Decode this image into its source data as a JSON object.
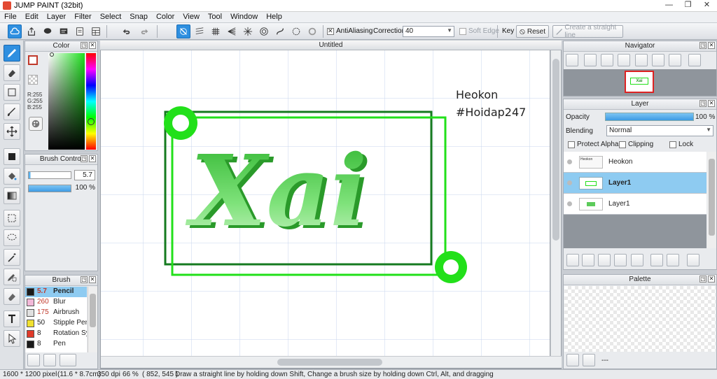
{
  "window": {
    "title": "JUMP PAINT (32bit)"
  },
  "menu": [
    "File",
    "Edit",
    "Layer",
    "Filter",
    "Select",
    "Snap",
    "Color",
    "View",
    "Tool",
    "Window",
    "Help"
  ],
  "toolbar": {
    "antialiasing_label": "AntiAliasing",
    "correction_label": "Correction",
    "correction_value": "40",
    "soft_edge_label": "Soft Edge",
    "key_label": "Key",
    "reset_label": "Reset",
    "straight_line_label": "Create a straight line"
  },
  "color_panel": {
    "title": "Color",
    "r": "R:255",
    "g": "G:255",
    "b": "B:255"
  },
  "brush_control": {
    "title": "Brush Control",
    "size": "5.7",
    "opacity": "100 %"
  },
  "brush_panel": {
    "title": "Brush",
    "items": [
      {
        "size": "5.7",
        "name": "Pencil",
        "color": "#1a1a1a"
      },
      {
        "size": "260",
        "name": "Blur",
        "color": "#f2b8d8"
      },
      {
        "size": "175",
        "name": "Airbrush",
        "color": "#e0e0e0"
      },
      {
        "size": "50",
        "name": "Stipple Pen",
        "color": "#f0e030"
      },
      {
        "size": "8",
        "name": "Rotation Sy",
        "color": "#e03a2a"
      },
      {
        "size": "8",
        "name": "Pen",
        "color": "#1a1a1a"
      }
    ]
  },
  "document": {
    "tab_title": "Untitled",
    "artwork_text": "Xai",
    "annotation_line1": "Heokon",
    "annotation_line2": "#Hoidap247"
  },
  "navigator": {
    "title": "Navigator"
  },
  "layer_panel": {
    "title": "Layer",
    "opacity_label": "Opacity",
    "opacity_value": "100 %",
    "opacity_fraction": 1.0,
    "blending_label": "Blending",
    "blending_value": "Normal",
    "protect_alpha_label": "Protect Alpha",
    "clipping_label": "Clipping",
    "lock_label": "Lock",
    "layers": [
      {
        "name": "Heokon",
        "selected": false
      },
      {
        "name": "Layer1",
        "selected": true
      },
      {
        "name": "Layer1",
        "selected": false
      }
    ]
  },
  "palette_panel": {
    "title": "Palette",
    "footer_text": "---"
  },
  "status": {
    "pixel_size": "1600 * 1200 pixel",
    "cm_size": "(11.6 * 8.7cm)",
    "dpi": "350 dpi",
    "zoom": "66 %",
    "cursor": "( 852, 545 )",
    "hint": "Draw a straight line by holding down Shift, Change a brush size by holding down Ctrl, Alt, and dragging"
  },
  "colors": {
    "accent": "#2e8fe0",
    "art_green": "#22e01a",
    "art_dark_green": "#157a1f",
    "text_green": "#5ccb5a"
  }
}
